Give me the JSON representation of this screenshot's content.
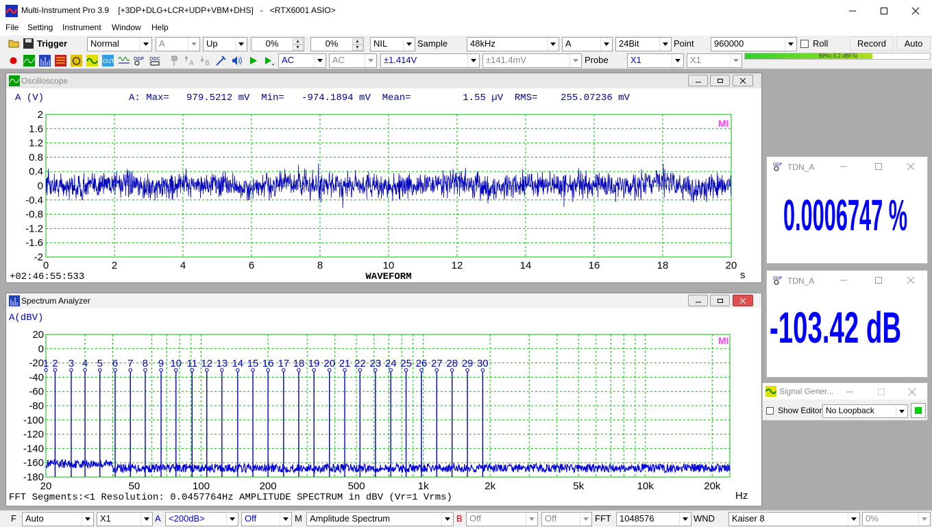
{
  "app": {
    "title": "Multi-Instrument Pro 3.9    [+3DP+DLG+LCR+UDP+VBM+DHS]   -   <RTX6001 ASIO>"
  },
  "menu": [
    "File",
    "Setting",
    "Instrument",
    "Window",
    "Help"
  ],
  "toolbar1": {
    "trigger_label": "Trigger",
    "trigger_mode": "Normal",
    "trigger_channel": "A",
    "trigger_edge": "Up",
    "trigger_level": "0%",
    "trigger_delay": "0%",
    "nil": "NIL",
    "sample_label": "Sample",
    "sample_rate": "48kHz",
    "channel": "A",
    "bits": "24Bit",
    "point_label": "Point",
    "points": "960000",
    "roll_label": "Roll",
    "record_label": "Record",
    "auto_label": "Auto"
  },
  "toolbar2": {
    "coupling_a": "AC",
    "coupling_b": "AC",
    "range_a": "±1.414V",
    "range_b": "±141.4mV",
    "probe_label": "Probe",
    "probe_a": "X1",
    "probe_b": "X1",
    "level_text": "69%(-3.2 dBFS)",
    "level_fraction": 0.69
  },
  "oscilloscope": {
    "title": "Oscilloscope",
    "channel_label": "A (V)",
    "stats": "A: Max=   979.5212 mV  Min=   -974.1894 mV  Mean=         1.55 µV  RMS=    255.07236 mV",
    "timestamp": "+02:46:55:533",
    "footer": "WAVEFORM",
    "x_unit": "s",
    "watermark": "MI",
    "y_ticks": [
      "2",
      "1.6",
      "1.2",
      "0.8",
      "0.4",
      "0",
      "-0.4",
      "-0.8",
      "-1.2",
      "-1.6",
      "-2"
    ],
    "x_ticks": [
      "0",
      "2",
      "4",
      "6",
      "8",
      "10",
      "12",
      "14",
      "16",
      "18",
      "20"
    ]
  },
  "spectrum": {
    "title": "Spectrum Analyzer",
    "ylabel": "A(dBV)",
    "footer": "FFT Segments:<1   Resolution: 0.0457764Hz  AMPLITUDE SPECTRUM in dBV (Vr=1 Vrms)",
    "x_unit": "Hz",
    "watermark": "MI",
    "y_ticks": [
      "20",
      "0",
      "-20",
      "-40",
      "-60",
      "-80",
      "-100",
      "-120",
      "-140",
      "-160",
      "-180"
    ],
    "x_ticks": [
      "20",
      "50",
      "100",
      "200",
      "500",
      "1k",
      "2k",
      "5k",
      "10k",
      "20k"
    ]
  },
  "chart_data": [
    {
      "type": "line",
      "xlabel": "",
      "ylabel": "A (V)",
      "xlim": [
        0,
        20
      ],
      "ylim": [
        -2,
        2
      ],
      "grid": true,
      "series": [
        {
          "x": [
            0,
            1,
            2,
            3,
            4,
            5,
            6,
            7,
            8,
            9,
            10,
            11,
            12,
            13,
            14,
            15,
            16,
            17,
            18,
            19,
            20
          ],
          "values": [
            0.05,
            -0.1,
            0.2,
            -0.15,
            0.1,
            0.05,
            -0.2,
            0.15,
            -0.05,
            0.1,
            -0.1,
            0.05,
            0.2,
            -0.15,
            0.1,
            -0.05,
            0.15,
            -0.1,
            0.3,
            -0.2,
            0.05
          ]
        }
      ],
      "notes_visible": {
        "max_mV": 979.5212,
        "min_mV": -974.1894,
        "rms_mV": 255.07236
      }
    },
    {
      "type": "line",
      "xlabel": "",
      "ylabel": "A(dBV)",
      "xscale": "log",
      "xlim": [
        20,
        24000
      ],
      "ylim": [
        -180,
        20
      ],
      "grid": true,
      "noise_floor_dBV": -170,
      "harmonic_labels": [
        "1",
        "2",
        "3",
        "4",
        "5",
        "6",
        "7",
        "8",
        "9",
        "10",
        "11",
        "12",
        "13",
        "14",
        "15",
        "16",
        "17",
        "18",
        "19",
        "20",
        "21",
        "22",
        "23",
        "24",
        "25",
        "26",
        "27",
        "28",
        "29",
        "30"
      ],
      "harmonic_freqs_hz": [
        20,
        22,
        26,
        30,
        35,
        41,
        48,
        56,
        66,
        77,
        91,
        106,
        124,
        146,
        171,
        200,
        235,
        275,
        322,
        378,
        443,
        519,
        609,
        714,
        837,
        981,
        1150,
        1348,
        1580,
        1852
      ],
      "harmonic_levels_dBV": [
        -20,
        -30,
        -30,
        -30,
        -30,
        -30,
        -30,
        -30,
        -30,
        -30,
        -30,
        -30,
        -30,
        -30,
        -30,
        -30,
        -30,
        -30,
        -30,
        -30,
        -30,
        -30,
        -30,
        -30,
        -30,
        -30,
        -30,
        -30,
        -30,
        -30
      ]
    }
  ],
  "tdn1": {
    "title": "TDN_A",
    "value": "0.0006747 %"
  },
  "tdn2": {
    "title": "TDN_A",
    "value": "-103.42 dB"
  },
  "siggen": {
    "title": "Signal Gener...",
    "show_editor_label": "Show Editor",
    "loopback": "No Loopback"
  },
  "statusbar": {
    "f_label": "F",
    "auto": "Auto",
    "x1": "X1",
    "a_label": "A",
    "range": "<200dB>",
    "off1": "Off",
    "m_label": "M",
    "mode": "Amplitude Spectrum",
    "b_label": "B",
    "off2": "Off",
    "off3": "Off",
    "fft_label": "FFT",
    "fft_size": "1048576",
    "wnd_label": "WND",
    "window": "Kaiser 8",
    "percent": "0%"
  },
  "colors": {
    "accent": "#0000ff",
    "grid": "#00c000",
    "trace": "#0000c0",
    "watermark": "#ff40ff"
  }
}
